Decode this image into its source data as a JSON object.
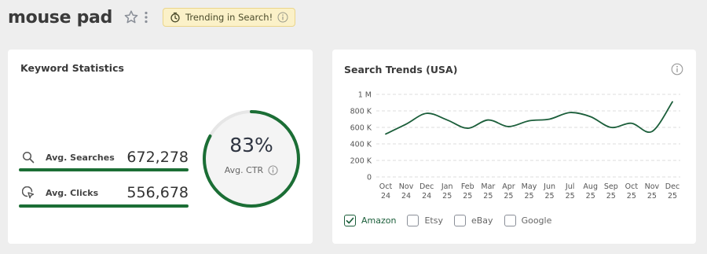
{
  "header": {
    "keyword": "mouse pad",
    "badge_text": "Trending in Search!"
  },
  "keyword_stats": {
    "title": "Keyword Statistics",
    "avg_searches_label": "Avg. Searches",
    "avg_searches_value": "672,278",
    "avg_clicks_label": "Avg. Clicks",
    "avg_clicks_value": "556,678",
    "ctr_value": "83%",
    "ctr_label": "Avg. CTR",
    "ctr_fraction": 0.83
  },
  "search_trends": {
    "title": "Search Trends (USA)",
    "legend": [
      {
        "label": "Amazon",
        "checked": true
      },
      {
        "label": "Etsy",
        "checked": false
      },
      {
        "label": "eBay",
        "checked": false
      },
      {
        "label": "Google",
        "checked": false
      }
    ]
  },
  "colors": {
    "accent_green": "#1b6e35",
    "line_green": "#1b5e3a",
    "badge_bg": "#fbf1c8"
  },
  "chart_data": {
    "type": "line",
    "title": "Search Trends (USA)",
    "xlabel": "",
    "ylabel": "",
    "ylim": [
      0,
      1000000
    ],
    "y_ticks": [
      0,
      200000,
      400000,
      600000,
      800000,
      1000000
    ],
    "y_tick_labels": [
      "0",
      "200 K",
      "400 K",
      "600 K",
      "800 K",
      "1 M"
    ],
    "categories": [
      "Oct 24",
      "Nov 24",
      "Dec 24",
      "Jan 25",
      "Feb 25",
      "Mar 25",
      "Apr 25",
      "May 25",
      "Jun 25",
      "Jul 25",
      "Aug 25",
      "Sep 25",
      "Oct 25",
      "Nov 25",
      "Dec 25"
    ],
    "x_tick_labels": [
      [
        "Oct",
        "24"
      ],
      [
        "Nov",
        "24"
      ],
      [
        "Dec",
        "24"
      ],
      [
        "Jan",
        "25"
      ],
      [
        "Feb",
        "25"
      ],
      [
        "Mar",
        "25"
      ],
      [
        "Apr",
        "25"
      ],
      [
        "May",
        "25"
      ],
      [
        "Jun",
        "25"
      ],
      [
        "Jul",
        "25"
      ],
      [
        "Aug",
        "25"
      ],
      [
        "Sep",
        "25"
      ],
      [
        "Oct",
        "25"
      ],
      [
        "Nov",
        "25"
      ],
      [
        "Dec",
        "25"
      ]
    ],
    "series": [
      {
        "name": "Amazon",
        "values": [
          520000,
          640000,
          770000,
          690000,
          590000,
          690000,
          610000,
          680000,
          700000,
          780000,
          730000,
          600000,
          650000,
          550000,
          910000
        ]
      }
    ],
    "grid": true,
    "legend_position": "bottom-left"
  }
}
